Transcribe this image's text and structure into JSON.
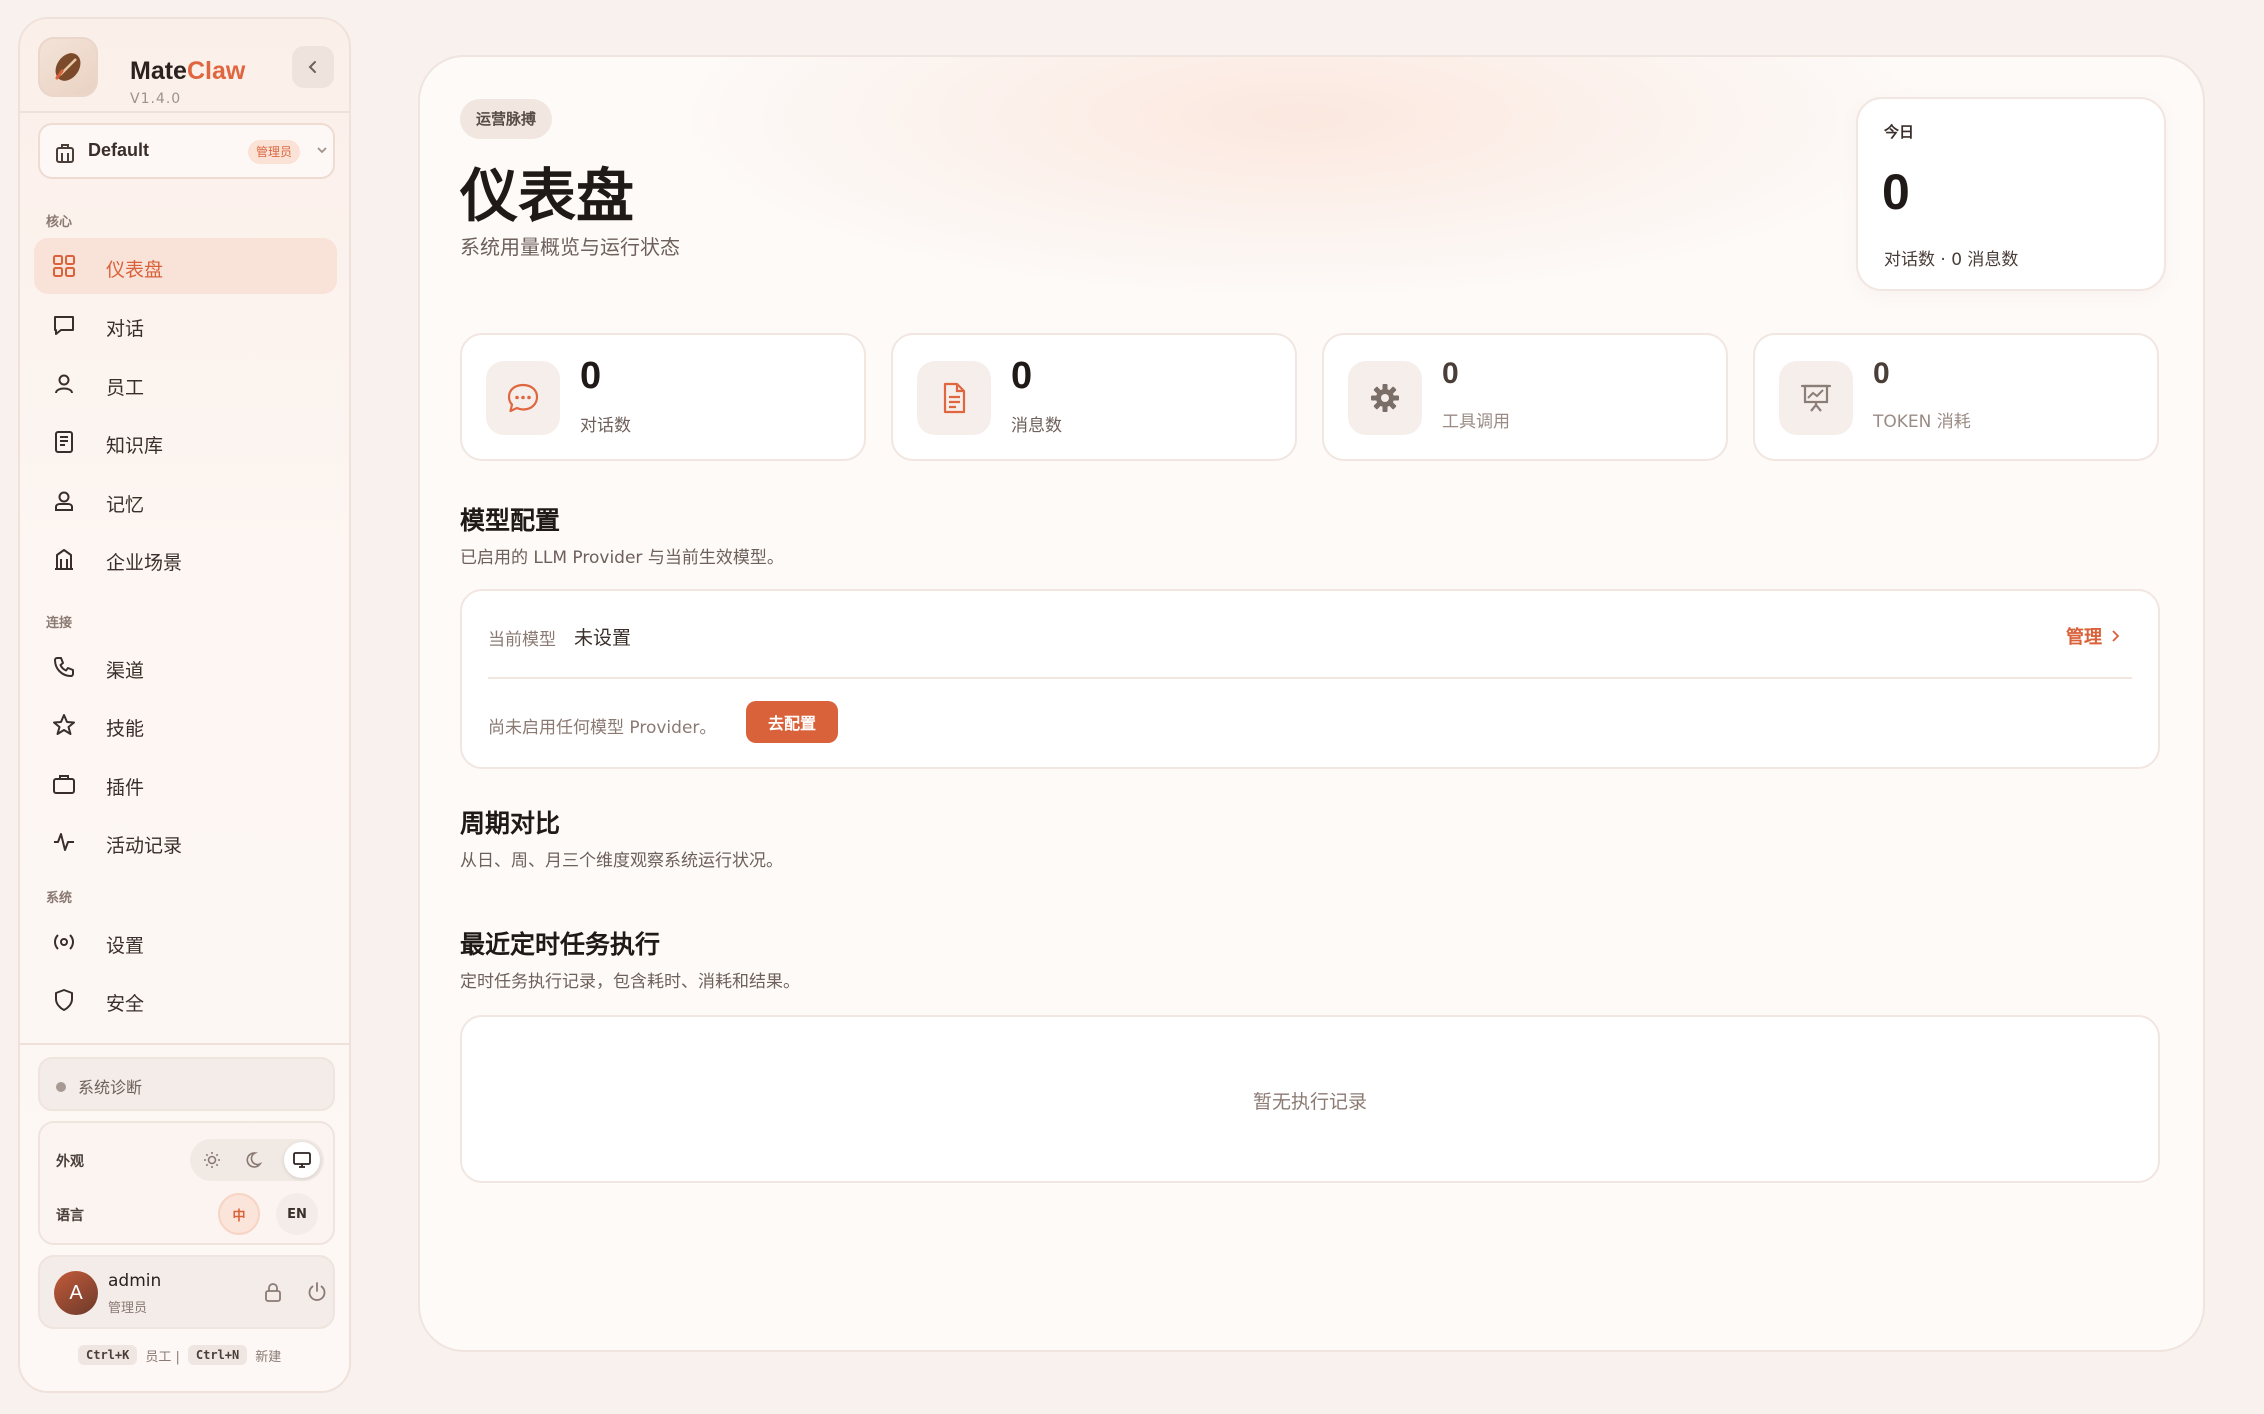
{
  "brand": {
    "name_primary": "Mate",
    "name_accent": "Claw",
    "version": "V1.4.0"
  },
  "workspace": {
    "name": "Default",
    "badge": "管理员"
  },
  "sidebar": {
    "sections": [
      {
        "label": "核心"
      },
      {
        "label": "连接"
      },
      {
        "label": "系统"
      }
    ],
    "items": [
      {
        "label": "仪表盘",
        "icon": "grid-icon",
        "active": true
      },
      {
        "label": "对话",
        "icon": "chat-icon"
      },
      {
        "label": "员工",
        "icon": "person-icon"
      },
      {
        "label": "知识库",
        "icon": "book-icon"
      },
      {
        "label": "记忆",
        "icon": "memory-icon"
      },
      {
        "label": "企业场景",
        "icon": "building-icon"
      },
      {
        "label": "渠道",
        "icon": "phone-icon"
      },
      {
        "label": "技能",
        "icon": "star-icon"
      },
      {
        "label": "插件",
        "icon": "briefcase-icon"
      },
      {
        "label": "活动记录",
        "icon": "activity-icon"
      },
      {
        "label": "设置",
        "icon": "settings-icon"
      },
      {
        "label": "安全",
        "icon": "shield-icon"
      }
    ],
    "diagnostics": "系统诊断",
    "appearance_label": "外观",
    "language_label": "语言",
    "lang_zh": "中",
    "lang_en": "EN",
    "user": {
      "initial": "A",
      "name": "admin",
      "role": "管理员"
    },
    "shortcuts": [
      {
        "key": "Ctrl+K",
        "label": "员工 |"
      },
      {
        "key": "Ctrl+N",
        "label": "新建"
      }
    ]
  },
  "header": {
    "badge": "运营脉搏",
    "title": "仪表盘",
    "subtitle": "系统用量概览与运行状态",
    "today": {
      "label": "今日",
      "value": "0",
      "meta": "对话数 · 0 消息数"
    }
  },
  "stats": [
    {
      "value": "0",
      "label": "对话数",
      "icon": "chat-bubble-icon"
    },
    {
      "value": "0",
      "label": "消息数",
      "icon": "document-icon"
    },
    {
      "value": "0",
      "label": "工具调用",
      "icon": "gear-icon"
    },
    {
      "value": "0",
      "label": "TOKEN 消耗",
      "icon": "presentation-chart-icon"
    }
  ],
  "model_config": {
    "title": "模型配置",
    "subtitle": "已启用的 LLM Provider 与当前生效模型。",
    "current_label": "当前模型",
    "current_value": "未设置",
    "manage_label": "管理",
    "empty_note": "尚未启用任何模型 Provider。",
    "configure_button": "去配置"
  },
  "period": {
    "title": "周期对比",
    "subtitle": "从日、周、月三个维度观察系统运行状况。"
  },
  "tasks": {
    "title": "最近定时任务执行",
    "subtitle": "定时任务执行记录，包含耗时、消耗和结果。",
    "empty": "暂无执行记录"
  },
  "colors": {
    "accent": "#d9623b",
    "background": "#f8f1ed",
    "active_nav": "#f9e2d8"
  }
}
